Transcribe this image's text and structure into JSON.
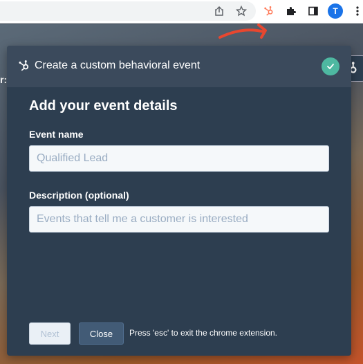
{
  "browser": {
    "icons": [
      "share-icon",
      "star-icon",
      "hubspot-extension-icon",
      "puzzle-icon",
      "sidepanel-icon",
      "kebab-menu-icon"
    ],
    "profile_initial": "T",
    "accent": "#1a73e8",
    "extension_color": "#ff7a59"
  },
  "background_page": {
    "partial_text": "r:"
  },
  "modal": {
    "title": "Create a custom behavioral event",
    "section_title": "Add your event details",
    "event_name": {
      "label": "Event name",
      "placeholder": "Qualified Lead",
      "value": ""
    },
    "description": {
      "label": "Description (optional)",
      "placeholder": "Events that tell me a customer is interested",
      "value": ""
    },
    "next_label": "Next",
    "close_label": "Close",
    "esc_hint": "Press 'esc' to exit the chrome extension.",
    "header_bg": "#3b4a5c",
    "body_bg": "#2d3e50",
    "check_color": "#4eb8a1"
  },
  "annotation_arrow_color": "#e8472f"
}
